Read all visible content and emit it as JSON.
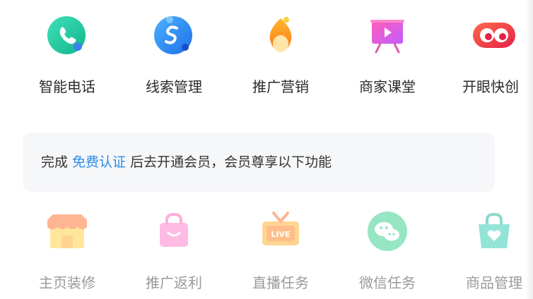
{
  "top_row": [
    {
      "label": "智能电话",
      "icon": "phone-icon"
    },
    {
      "label": "线索管理",
      "icon": "lead-icon"
    },
    {
      "label": "推广营销",
      "icon": "promo-icon"
    },
    {
      "label": "商家课堂",
      "icon": "classroom-icon"
    },
    {
      "label": "开眼快创",
      "icon": "eye-create-icon"
    }
  ],
  "banner": {
    "prefix": "完成 ",
    "link": "免费认证",
    "suffix": " 后去开通会员，会员尊享以下功能"
  },
  "bottom_row": [
    {
      "label": "主页装修",
      "icon": "storefront-icon"
    },
    {
      "label": "推广返利",
      "icon": "shopping-bag-icon"
    },
    {
      "label": "直播任务",
      "icon": "live-tv-icon"
    },
    {
      "label": "微信任务",
      "icon": "wechat-icon"
    },
    {
      "label": "商品管理",
      "icon": "product-bag-icon"
    }
  ],
  "colors": {
    "link": "#2d8ce6",
    "disabled_label": "#9a9a9a"
  }
}
